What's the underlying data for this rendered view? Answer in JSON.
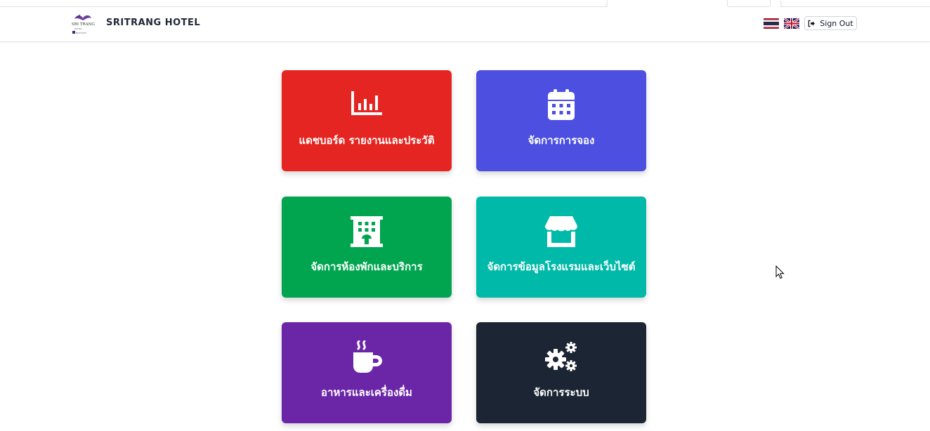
{
  "header": {
    "brand_name": "SRITRANG HOTEL",
    "logo_icon": "sritrang-hotel-logo",
    "languages": [
      {
        "code": "th",
        "icon": "thai-flag-icon"
      },
      {
        "code": "en",
        "icon": "uk-flag-icon"
      }
    ],
    "signout": {
      "label": "Sign Out",
      "icon": "sign-out-icon"
    }
  },
  "menu": [
    {
      "label": "แดชบอร์ด รายงานและประวัติ",
      "icon": "chart-icon",
      "color": "#e52521"
    },
    {
      "label": "จัดการการจอง",
      "icon": "calendar-icon",
      "color": "#4c4fe0"
    },
    {
      "label": "จัดการห้องพักและบริการ",
      "icon": "building-icon",
      "color": "#01a54f"
    },
    {
      "label": "จัดการข้อมูลโรงแรมและเว็บไซต์",
      "icon": "store-icon",
      "color": "#00b9a8"
    },
    {
      "label": "อาหารและเครื่องดื่ม",
      "icon": "coffee-cup-icon",
      "color": "#6b26a8"
    },
    {
      "label": "จัดการระบบ",
      "icon": "gears-icon",
      "color": "#1c2533"
    }
  ]
}
